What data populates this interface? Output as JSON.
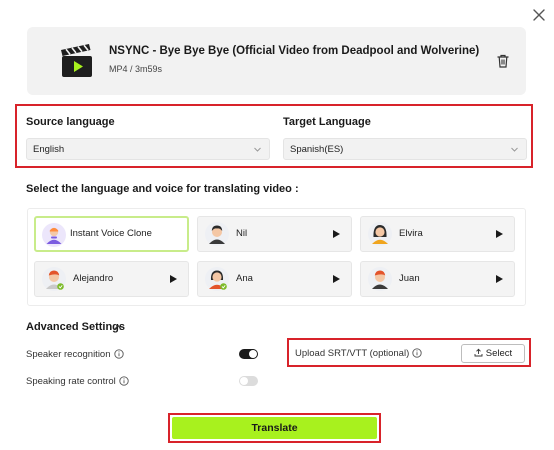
{
  "file": {
    "title": "NSYNC - Bye Bye Bye (Official Video from Deadpool and Wolverine)",
    "meta": "MP4 / 3m59s"
  },
  "source": {
    "label": "Source language",
    "value": "English"
  },
  "target": {
    "label": "Target Language",
    "value": "Spanish(ES)"
  },
  "voice_heading": "Select the language and voice for translating video :",
  "voices": [
    {
      "name": "Instant Voice Clone",
      "selected": true
    },
    {
      "name": "Nil"
    },
    {
      "name": "Elvira"
    },
    {
      "name": "Alejandro"
    },
    {
      "name": "Ana"
    },
    {
      "name": "Juan"
    }
  ],
  "advanced": {
    "heading": "Advanced Settings",
    "speaker_recognition": {
      "label": "Speaker recognition",
      "enabled": true
    },
    "speaking_rate": {
      "label": "Speaking rate control",
      "enabled": false
    }
  },
  "upload": {
    "label": "Upload SRT/VTT (optional)",
    "button": "Select"
  },
  "translate_button": "Translate",
  "colors": {
    "accent_green": "#a8f11e",
    "highlight_red": "#d8232a",
    "selected_border": "#c8ec8a"
  }
}
